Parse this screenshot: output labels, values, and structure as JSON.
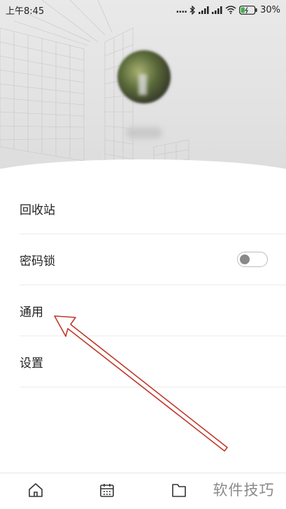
{
  "status_bar": {
    "time": "上午8:45",
    "signal_text": "....",
    "battery_level": "30%",
    "battery_fraction": 0.3,
    "battery_color": "#3cb44a"
  },
  "menu": {
    "items": [
      {
        "label": "回收站"
      },
      {
        "label": "密码锁",
        "toggle_on": false
      },
      {
        "label": "通用"
      },
      {
        "label": "设置"
      }
    ]
  },
  "bottom_nav": {
    "icons": [
      "home-icon",
      "calendar-icon",
      "folder-icon"
    ]
  },
  "watermark": {
    "text": "软件技巧"
  },
  "colors": {
    "annotation_arrow": "#c0392b",
    "text_primary": "#222222",
    "divider": "#ececec"
  }
}
